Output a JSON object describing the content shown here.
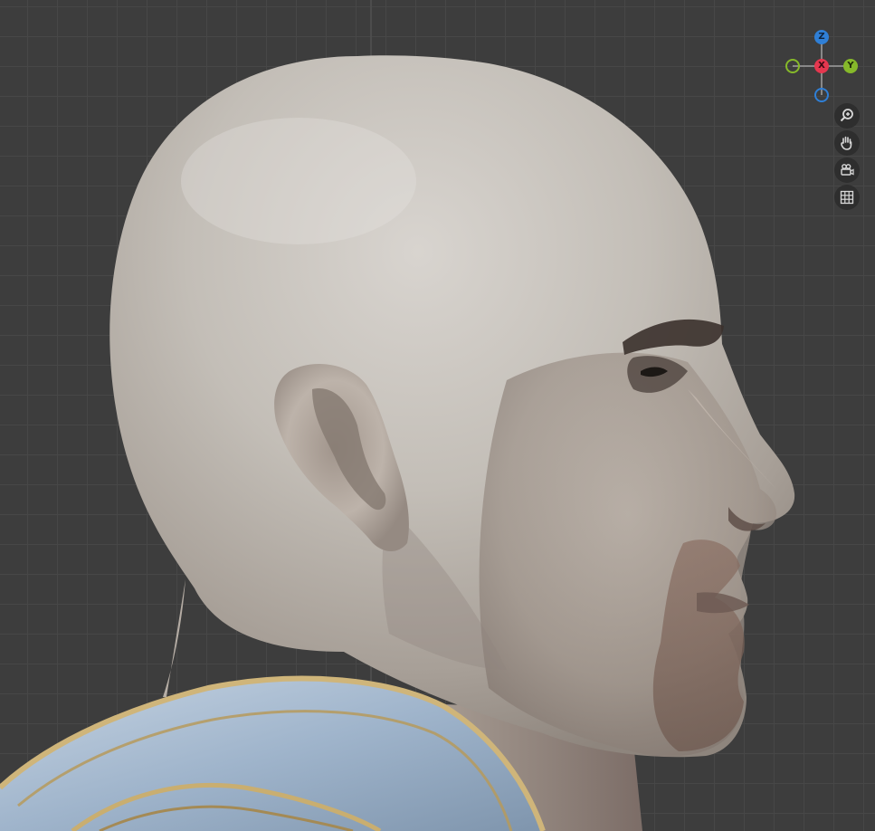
{
  "viewport": {
    "background_color": "#3d3d3d",
    "grid_color": "#474747"
  },
  "gizmo": {
    "z_label": "Z",
    "x_label": "X",
    "y_label": "Y",
    "z_color": "#2f7fd6",
    "x_color": "#e5374f",
    "y_color": "#86b92a"
  },
  "nav_buttons": [
    {
      "icon": "zoom-icon"
    },
    {
      "icon": "hand-pan-icon"
    },
    {
      "icon": "camera-view-icon"
    },
    {
      "icon": "grid-toggle-icon"
    }
  ]
}
